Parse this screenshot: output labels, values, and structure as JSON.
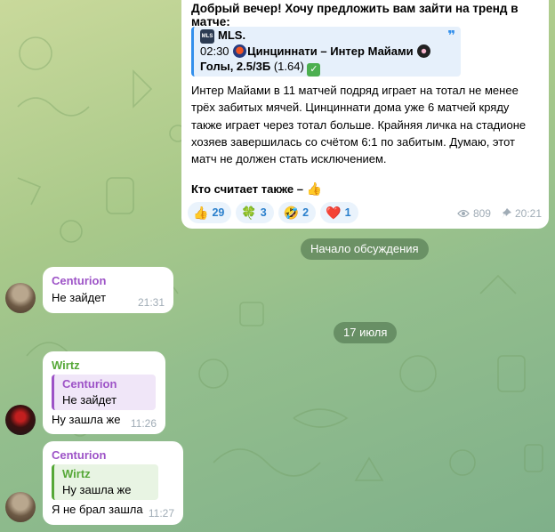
{
  "channel_post": {
    "heading": "Добрый вечер! Хочу предложить вам зайти на тренд в матче:",
    "quote": {
      "league": "MLS.",
      "time": "02:30",
      "match": "Цинциннати – Интер Майами",
      "bet": "Голы, 2.5/3Б",
      "odds": "(1.64)"
    },
    "body": "Интер Майами в 11 матчей подряд играет на тотал не менее трёх забитых мячей. Цинциннати дома уже 6 матчей кряду также играет через тотал больше. Крайняя личка на стадионе хозяев завершилась со счётом 6:1 по забитым. Думаю, этот матч не должен стать исключением.",
    "ask": "Кто считает также –",
    "ask_emoji": "👍",
    "reactions": [
      {
        "emoji": "👍",
        "count": "29"
      },
      {
        "emoji": "🍀",
        "count": "3"
      },
      {
        "emoji": "🤣",
        "count": "2"
      },
      {
        "emoji": "❤️",
        "count": "1"
      }
    ],
    "views": "809",
    "time": "20:21"
  },
  "service": {
    "discussion_start": "Начало обсуждения",
    "date": "17 июля"
  },
  "messages": [
    {
      "sender": "Centurion",
      "text": "Не зайдет",
      "time": "21:31"
    },
    {
      "sender": "Wirtz",
      "reply_name": "Centurion",
      "reply_text": "Не зайдет",
      "text": "Ну зашла же",
      "time": "11:26"
    },
    {
      "sender": "Centurion",
      "reply_name": "Wirtz",
      "reply_text": "Ну зашла же",
      "text": "Я не брал зашла",
      "time": "11:27"
    }
  ]
}
